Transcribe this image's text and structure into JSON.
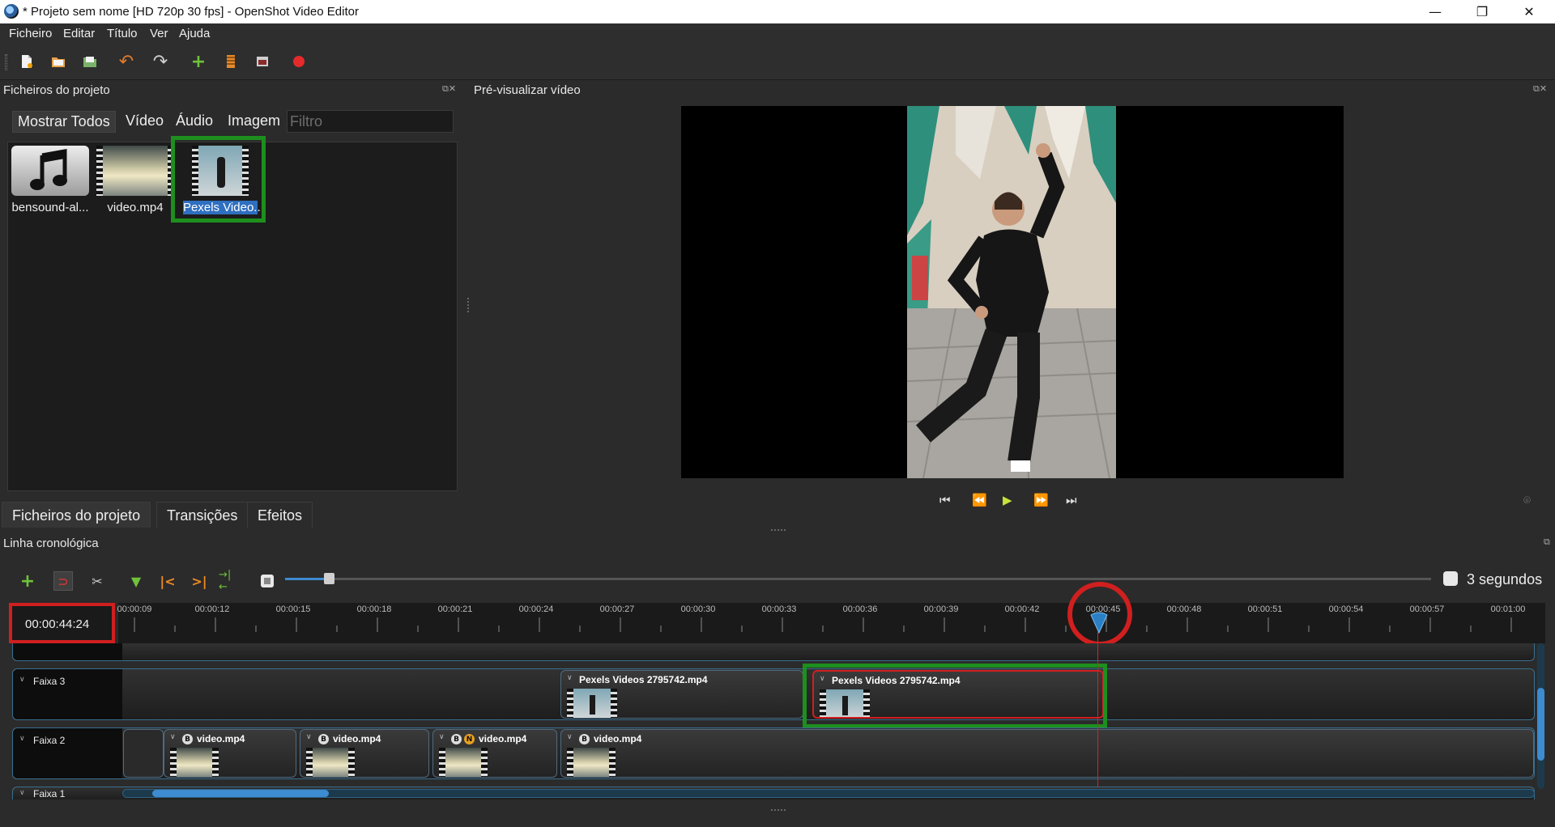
{
  "window": {
    "title": "* Projeto sem nome [HD 720p 30 fps] - OpenShot Video Editor",
    "minimize": "—",
    "maximize": "❐",
    "close": "✕"
  },
  "menu": [
    "Ficheiro",
    "Editar",
    "Título",
    "Ver",
    "Ajuda"
  ],
  "project_files": {
    "title": "Ficheiros do projeto",
    "filters": [
      "Mostrar Todos",
      "Vídeo",
      "Áudio",
      "Imagem"
    ],
    "filter_placeholder": "Filtro",
    "items": [
      {
        "label": "bensound-al..."
      },
      {
        "label": "video.mp4"
      },
      {
        "label": "Pexels Video..."
      }
    ]
  },
  "bottom_tabs": [
    "Ficheiros do projeto",
    "Transições",
    "Efeitos"
  ],
  "preview": {
    "title": "Pré-visualizar vídeo"
  },
  "timeline": {
    "title": "Linha cronológica",
    "zoom_label": "3 segundos",
    "timecode": "00:00:44:24",
    "ruler_labels": [
      "00:00:09",
      "00:00:12",
      "00:00:15",
      "00:00:18",
      "00:00:21",
      "00:00:24",
      "00:00:27",
      "00:00:30",
      "00:00:33",
      "00:00:36",
      "00:00:39",
      "00:00:42",
      "00:00:45",
      "00:00:48",
      "00:00:51",
      "00:00:54",
      "00:00:57",
      "00:01:00"
    ],
    "tracks": [
      {
        "name": "Faixa 3",
        "clips": [
          {
            "title": "Pexels Videos 2795742.mp4"
          },
          {
            "title": "Pexels Videos 2795742.mp4"
          }
        ]
      },
      {
        "name": "Faixa 2",
        "clips": [
          {
            "title": "video.mp4"
          },
          {
            "title": "video.mp4"
          },
          {
            "title": "video.mp4"
          },
          {
            "title": "video.mp4"
          }
        ]
      },
      {
        "name": "Faixa 1"
      }
    ]
  },
  "colors": {
    "highlight_red": "#d01f1f",
    "highlight_green": "#1e8f1e",
    "playhead": "#e02020",
    "accent_blue": "#3d8bd0"
  }
}
